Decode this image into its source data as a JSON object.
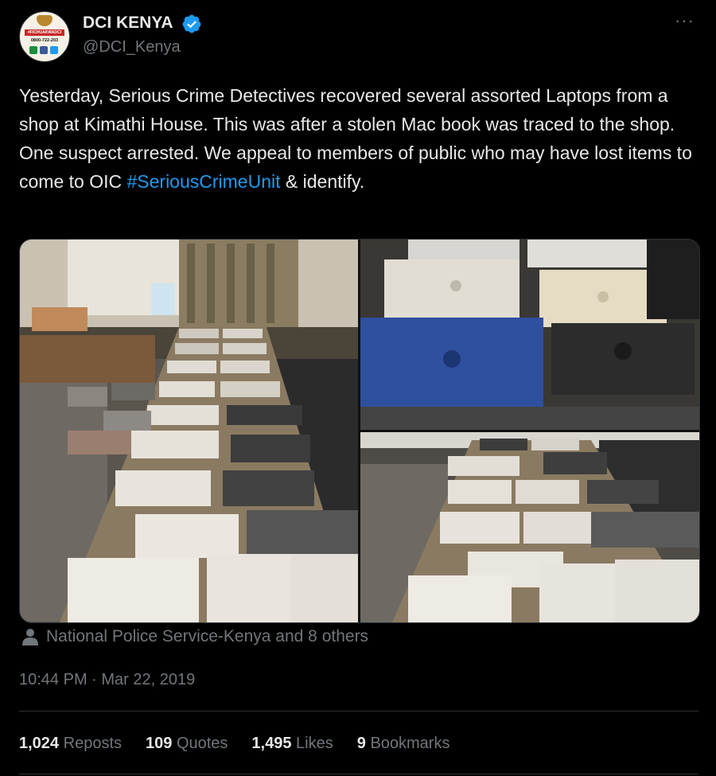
{
  "author": {
    "display_name": "DCI KENYA",
    "handle": "@DCI_Kenya",
    "avatar_text": {
      "hashtag": "#FICHUAKWADCI",
      "phone": "0800-722-203"
    }
  },
  "tweet": {
    "text_before_hashtag": "Yesterday, Serious Crime Detectives recovered several assorted Laptops from a shop at Kimathi House. This was after a stolen Mac book was traced to the shop. One suspect arrested. We appeal to members of public who may have lost items to come to OIC ",
    "hashtag": "#SeriousCrimeUnit",
    "text_after_hashtag": " & identify."
  },
  "tagged_people": "National Police Service-Kenya and 8 others",
  "timestamp": "10:44 PM · Mar 22, 2019",
  "stats": {
    "reposts": {
      "count": "1,024",
      "label": "Reposts"
    },
    "quotes": {
      "count": "109",
      "label": "Quotes"
    },
    "likes": {
      "count": "1,495",
      "label": "Likes"
    },
    "bookmarks": {
      "count": "9",
      "label": "Bookmarks"
    }
  },
  "icons": {
    "verified": "verified-badge-icon",
    "more": "more-options-icon",
    "tagged": "person-icon"
  },
  "colors": {
    "background": "#000000",
    "text": "#e7e9ea",
    "secondary_text": "#71767b",
    "link": "#1d9bf0",
    "divider": "#2f3336"
  }
}
